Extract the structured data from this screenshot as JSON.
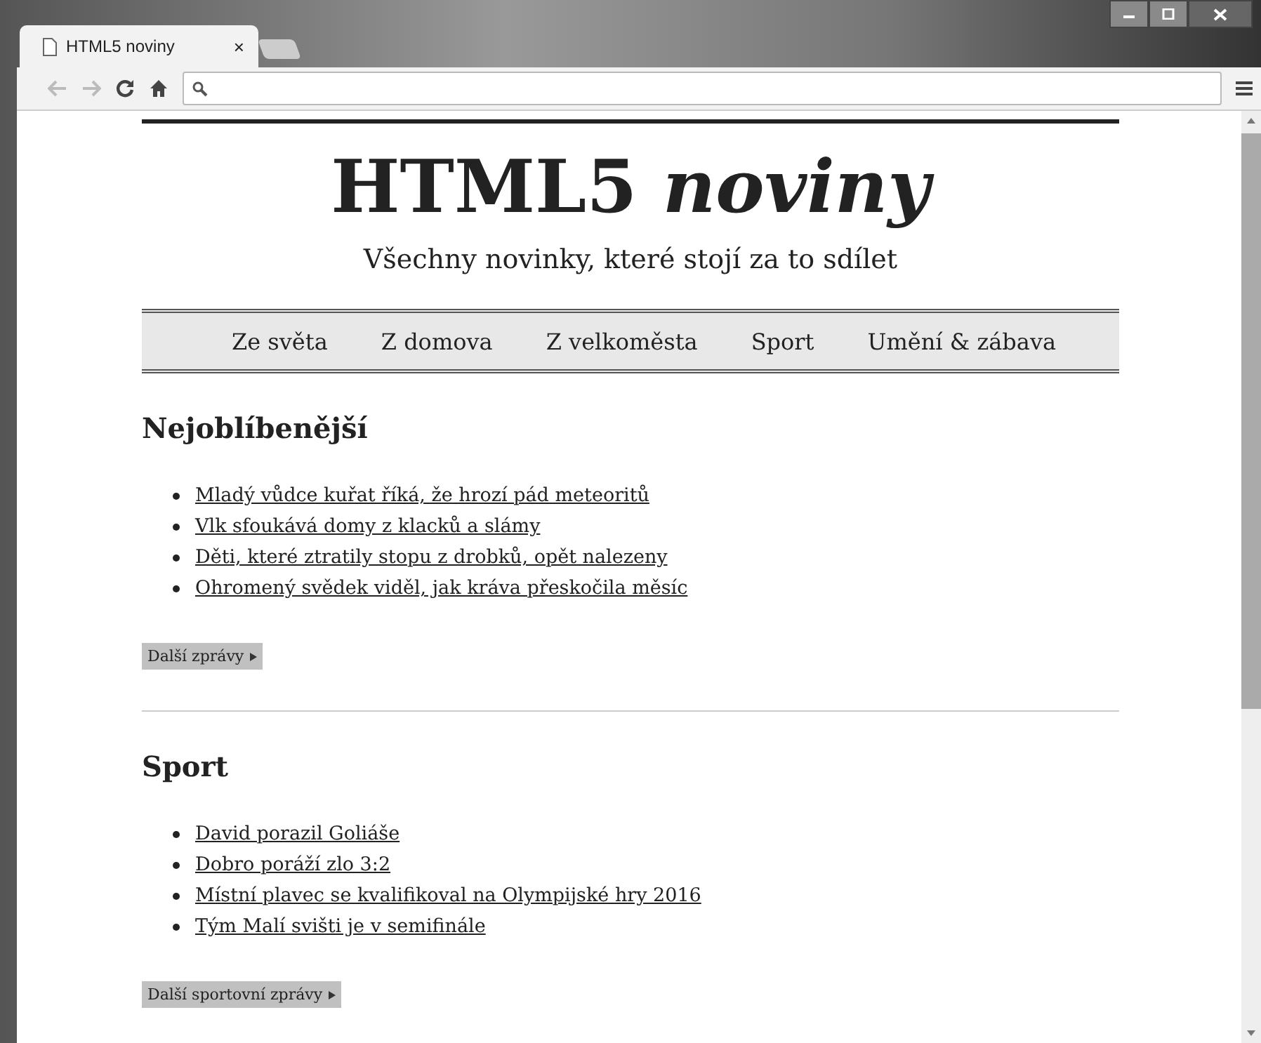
{
  "browser": {
    "tab_title": "HTML5 noviny",
    "tab_close": "×"
  },
  "site": {
    "title": "HTML5",
    "title_italic": "noviny",
    "tagline": "Všechny novinky, které stojí za to sdílet"
  },
  "nav": [
    "Ze světa",
    "Z domova",
    "Z velkoměsta",
    "Sport",
    "Umění & zábava"
  ],
  "sections": [
    {
      "heading": "Nejoblíbenější",
      "links": [
        "Mladý vůdce kuřat říká, že hrozí pád meteoritů",
        "Vlk sfoukává domy z klacků a slámy",
        "Děti, které ztratily stopu z drobků, opět nalezeny",
        "Ohromený svědek viděl, jak kráva přeskočila měsíc"
      ],
      "more": "Další zprávy"
    },
    {
      "heading": "Sport",
      "links": [
        "David porazil Goliáše",
        "Dobro poráží zlo 3:2",
        "Místní plavec se kvalifikoval na Olympijské hry 2016",
        "Tým Malí svišti je v semifinále"
      ],
      "more": "Další sportovní zprávy"
    }
  ]
}
